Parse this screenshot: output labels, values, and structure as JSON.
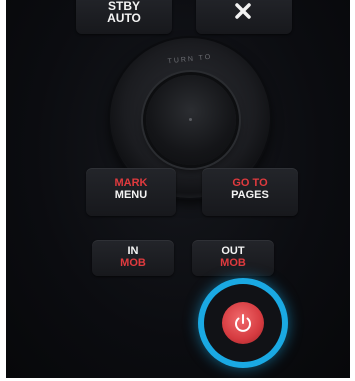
{
  "keys": {
    "standby_auto": {
      "line1": "STBY",
      "line2": "AUTO"
    },
    "mark_menu": {
      "top": "MARK",
      "bottom": "MENU"
    },
    "goto_pages": {
      "top": "GO TO",
      "bottom": "PAGES"
    },
    "in_mob": {
      "top": "IN",
      "bottom": "MOB"
    },
    "out_mob": {
      "top": "OUT",
      "bottom": "MOB"
    }
  },
  "knob": {
    "ring_text": "TURN TO"
  },
  "icons": {
    "close": "close-icon",
    "power": "power-icon"
  },
  "colors": {
    "accent_blue": "#1aa9e3",
    "label_red": "#e03a3e",
    "power_red": "#d63b40"
  }
}
